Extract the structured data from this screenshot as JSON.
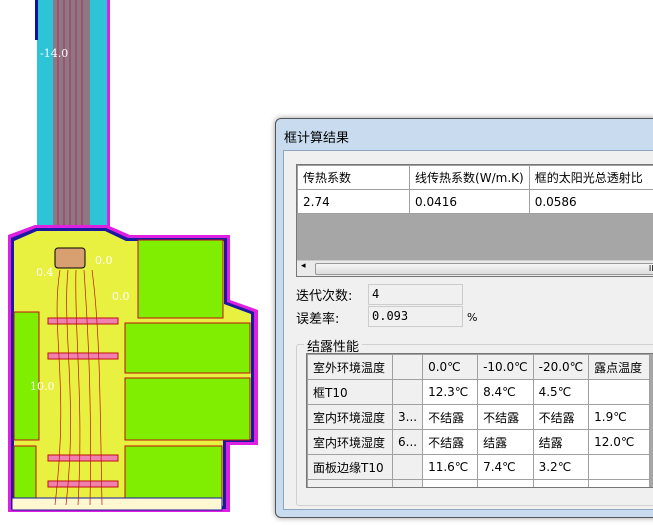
{
  "drawing": {
    "labels": [
      "-14.0",
      "0.0",
      "0.4",
      "0.0",
      "10.0"
    ]
  },
  "dialog": {
    "title": "框计算结果",
    "results": {
      "headers": [
        "传热系数",
        "线传热系数(W/m.K)",
        "框的太阳光总透射比"
      ],
      "values": [
        "2.74",
        "0.0416",
        "0.0586"
      ],
      "scroll_glyph": "III",
      "scroll_left": "◂"
    },
    "iterations": {
      "label": "迭代次数:",
      "value": "4"
    },
    "error": {
      "label": "误差率:",
      "value": "0.093",
      "unit": "%"
    },
    "condensation": {
      "title": "结露性能",
      "rows": [
        [
          "室外环境温度",
          "",
          "0.0℃",
          "-10.0℃",
          "-20.0℃",
          "露点温度"
        ],
        [
          "框T10",
          "",
          "12.3℃",
          "8.4℃",
          "4.5℃",
          ""
        ],
        [
          "室内环境湿度",
          "3...",
          "不结露",
          "不结露",
          "不结露",
          "1.9℃"
        ],
        [
          "室内环境湿度",
          "6...",
          "不结露",
          "结露",
          "结露",
          "12.0℃"
        ],
        [
          "面板边缘T10",
          "",
          "11.6℃",
          "7.4℃",
          "3.2℃",
          ""
        ],
        [
          "",
          "",
          "",
          "",
          "",
          ""
        ]
      ]
    }
  }
}
